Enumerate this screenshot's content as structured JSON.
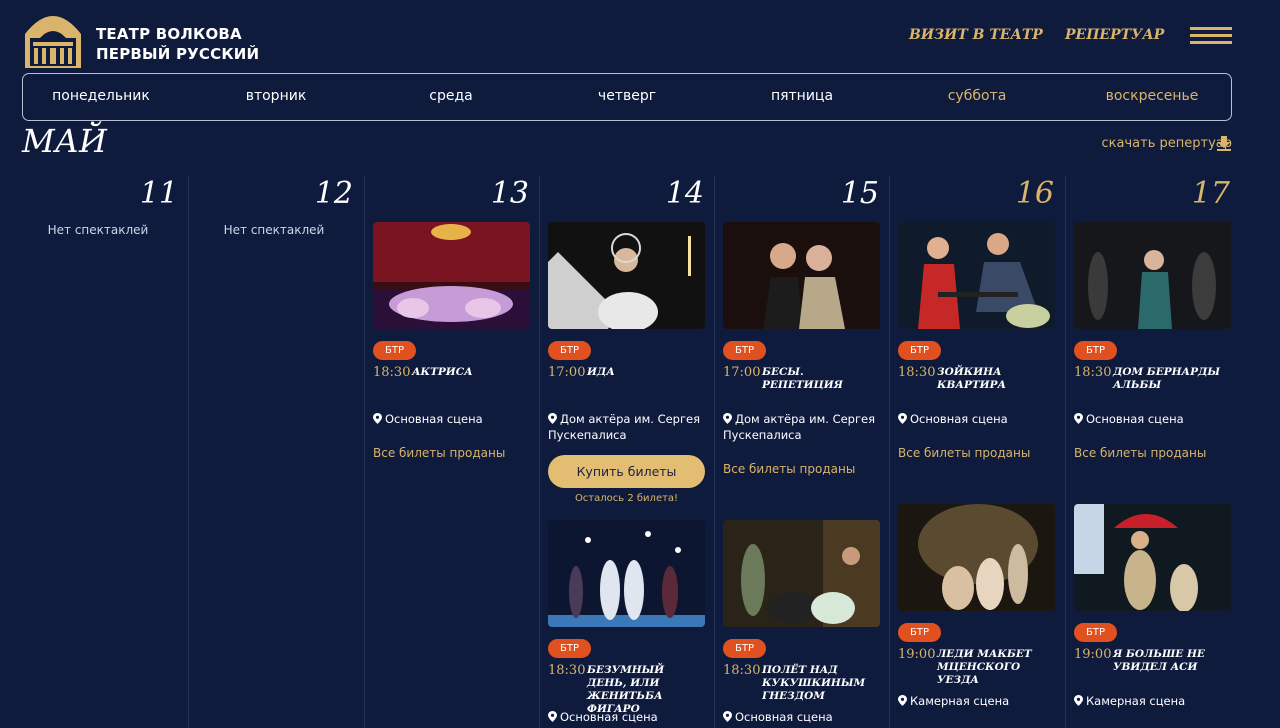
{
  "header": {
    "logo_line1": "ТЕАТР ВОЛКОВА",
    "logo_line2": "ПЕРВЫЙ РУССКИЙ",
    "nav": [
      "ВИЗИТ В ТЕАТР",
      "РЕПЕРТУАР"
    ],
    "menu_icon": "hamburger-menu-icon"
  },
  "weekdays": [
    "понедельник",
    "вторник",
    "среда",
    "четверг",
    "пятница",
    "суббота",
    "воскресенье"
  ],
  "month": "МАЙ",
  "download_label": "скачать репертуар",
  "days": [
    {
      "date": "11",
      "weekend": false,
      "no_shows": "Нет спектаклей"
    },
    {
      "date": "12",
      "weekend": false,
      "no_shows": "Нет спектаклей"
    },
    {
      "date": "13",
      "weekend": false
    },
    {
      "date": "14",
      "weekend": false
    },
    {
      "date": "15",
      "weekend": false
    },
    {
      "date": "16",
      "weekend": true
    },
    {
      "date": "17",
      "weekend": true
    }
  ],
  "events": [
    {
      "day": "13",
      "badge": "БТР",
      "time": "18:30",
      "title": "АКТРИСА",
      "venue": "Основная сцена",
      "status": "Все билеты проданы"
    },
    {
      "day": "14",
      "badge": "БТР",
      "time": "17:00",
      "title": "ИДА",
      "venue": "Дом актёра им. Сергея Пускепалиса",
      "buy_label": "Купить билеты",
      "tickets_left": "Осталось 2 билета!"
    },
    {
      "day": "14",
      "badge": "БТР",
      "time": "18:30",
      "title": "БЕЗУМНЫЙ ДЕНЬ, ИЛИ ЖЕНИТЬБА ФИГАРО",
      "venue": "Основная сцена"
    },
    {
      "day": "15",
      "badge": "БТР",
      "time": "17:00",
      "title": "БЕСЫ. РЕПЕТИЦИЯ",
      "venue": "Дом актёра им. Сергея Пускепалиса",
      "status": "Все билеты проданы"
    },
    {
      "day": "15",
      "badge": "БТР",
      "time": "18:30",
      "title": "ПОЛЁТ НАД КУКУШКИНЫМ ГНЕЗДОМ",
      "venue": "Основная сцена"
    },
    {
      "day": "16",
      "badge": "БТР",
      "time": "18:30",
      "title": "ЗОЙКИНА КВАРТИРА",
      "venue": "Основная сцена",
      "status": "Все билеты проданы"
    },
    {
      "day": "16",
      "badge": "БТР",
      "time": "19:00",
      "title": "ЛЕДИ МАКБЕТ МЦЕНСКОГО УЕЗДА",
      "venue": "Камерная сцена"
    },
    {
      "day": "17",
      "badge": "БТР",
      "time": "18:30",
      "title": "ДОМ БЕРНАРДЫ АЛЬБЫ",
      "venue": "Основная сцена",
      "status": "Все билеты проданы"
    },
    {
      "day": "17",
      "badge": "БТР",
      "time": "19:00",
      "title": "Я БОЛЬШЕ НЕ УВИДЕЛ АСИ",
      "venue": "Камерная сцена"
    }
  ],
  "colors": {
    "background": "#0f1b3d",
    "gold": "#d9b46a",
    "badge": "#e0511f",
    "button": "#e3bd72"
  }
}
